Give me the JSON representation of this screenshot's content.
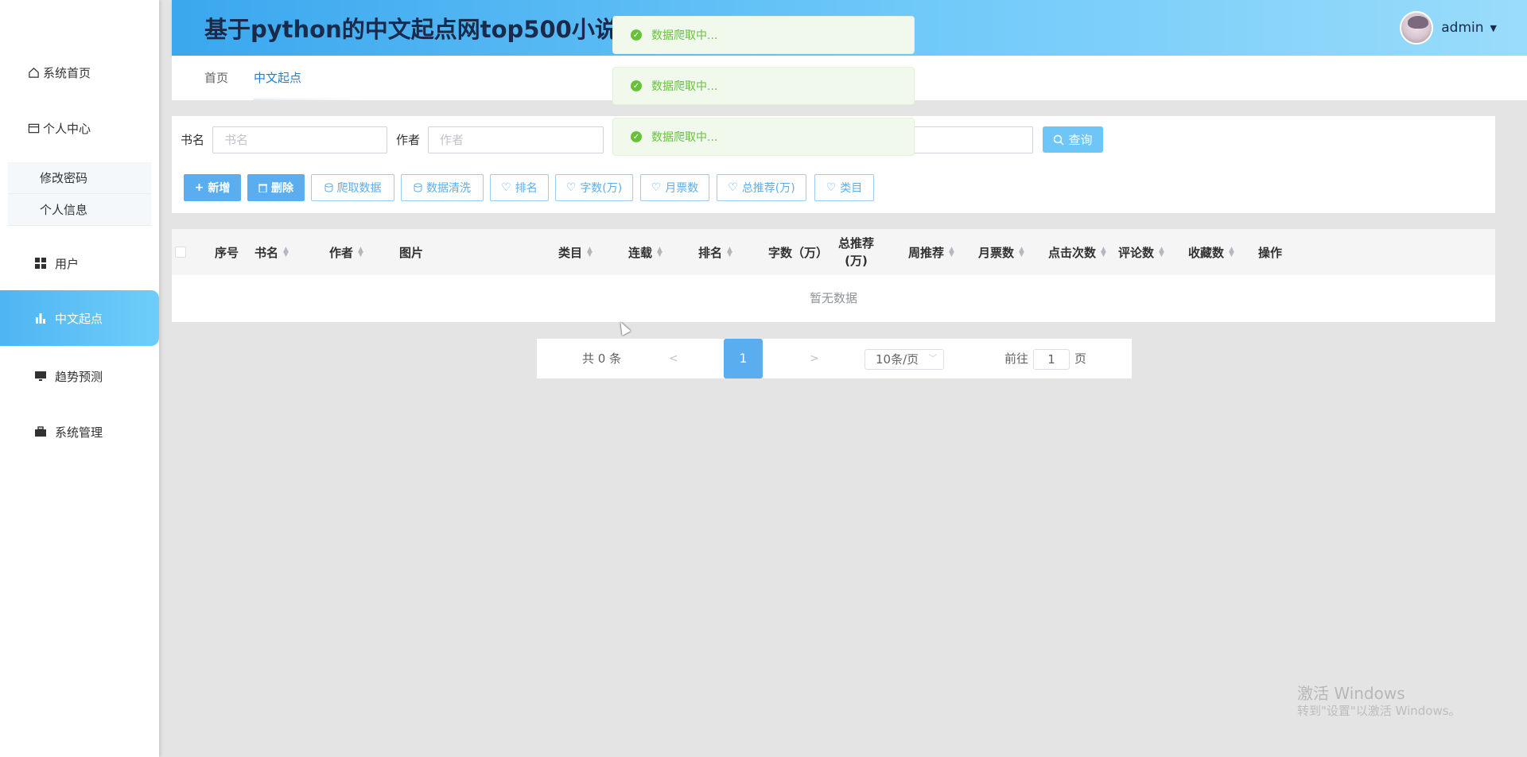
{
  "app": {
    "title": "基于python的中文起点网top500小说",
    "user": "admin"
  },
  "sidebar": {
    "items": [
      {
        "label": "系统首页",
        "icon": "home-icon"
      },
      {
        "label": "个人中心",
        "icon": "personal-center-icon"
      },
      {
        "label": "用户",
        "icon": "grid-icon"
      },
      {
        "label": "中文起点",
        "icon": "bar-chart-icon"
      },
      {
        "label": "趋势预测",
        "icon": "monitor-icon"
      },
      {
        "label": "系统管理",
        "icon": "briefcase-icon"
      }
    ],
    "submenu": [
      {
        "label": "修改密码"
      },
      {
        "label": "个人信息"
      }
    ],
    "active": "中文起点",
    "accent": "#4fb5f3"
  },
  "breadcrumb": {
    "home": "首页",
    "current": "中文起点"
  },
  "search": {
    "book_label": "书名",
    "book_placeholder": "书名",
    "author_label": "作者",
    "author_placeholder": "作者",
    "query_button": "查询"
  },
  "toolbar": {
    "add": "新增",
    "delete": "删除",
    "crawl": "爬取数据",
    "clean": "数据清洗",
    "rank": "排名",
    "words": "字数(万)",
    "monthly": "月票数",
    "total_rec": "总推荐(万)",
    "category": "类目"
  },
  "table": {
    "columns": {
      "index": "序号",
      "name": "书名",
      "author": "作者",
      "image": "图片",
      "category": "类目",
      "serial": "连载",
      "rank": "排名",
      "words": "字数（万）",
      "total_rec_line1": "总推荐",
      "total_rec_line2": "(万)",
      "weekly": "周推荐",
      "monthly": "月票数",
      "clicks": "点击次数",
      "comments": "评论数",
      "favorites": "收藏数",
      "actions": "操作"
    },
    "empty_text": "暂无数据"
  },
  "pagination": {
    "total": "共 0 条",
    "prev": "<",
    "current": "1",
    "next": ">",
    "page_size": "10条/页",
    "goto": "前往",
    "goto_value": "1",
    "unit": "页"
  },
  "notifications": [
    "数据爬取中...",
    "数据爬取中...",
    "数据爬取中..."
  ],
  "watermark": {
    "line1": "激活 Windows",
    "line2": "转到\"设置\"以激活 Windows。"
  },
  "colors": {
    "primary": "#5aaef0",
    "success": "#67c23a",
    "header": "#3aa7ee"
  }
}
